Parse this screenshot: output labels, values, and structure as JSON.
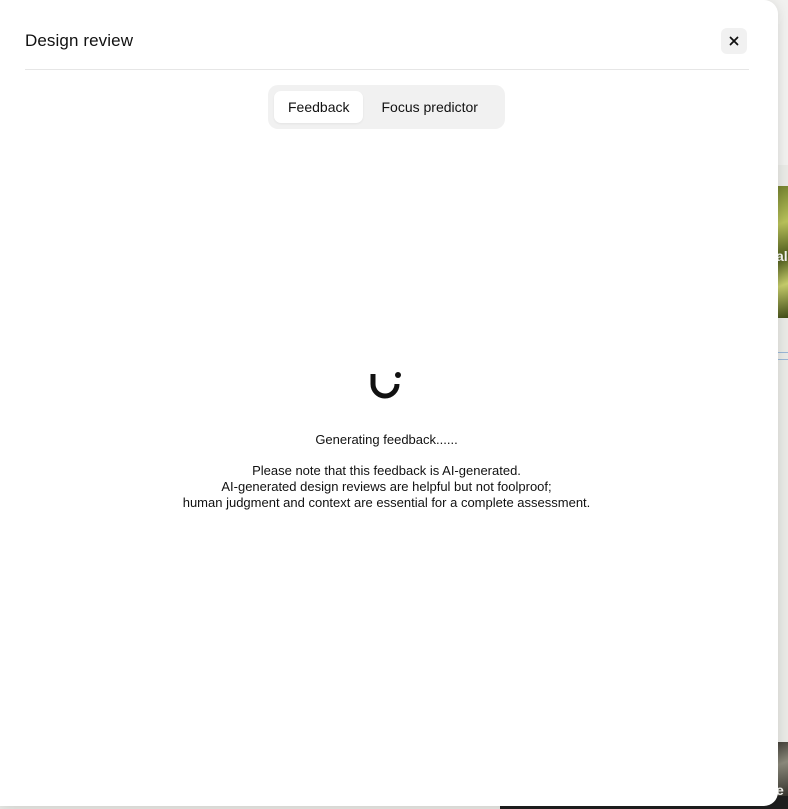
{
  "modal": {
    "title": "Design review",
    "close_icon": "close-icon"
  },
  "tabs": [
    {
      "label": "Feedback",
      "active": true
    },
    {
      "label": "Focus predictor",
      "active": false
    }
  ],
  "loading": {
    "icon": "spinner-icon",
    "status": "Generating feedback......"
  },
  "notice": {
    "line1": "Please note that this feedback is AI-generated.",
    "line2": "AI-generated design reviews are helpful but not foolproof;",
    "line3": "human judgment and context are essential for a complete assessment."
  },
  "background": {
    "photo_text_1": "al",
    "photo_text_2": "e"
  },
  "colors": {
    "modal_bg": "#ffffff",
    "tab_track": "#f1f1f1",
    "text": "#111111"
  }
}
